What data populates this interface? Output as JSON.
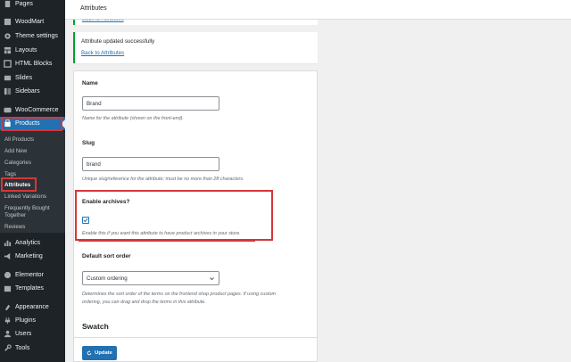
{
  "sidebar": {
    "items": [
      {
        "label": "Pages",
        "icon": "pages-icon"
      },
      {
        "label": "WoodMart",
        "icon": "woodmart-icon"
      },
      {
        "label": "Theme settings",
        "icon": "gear-icon"
      },
      {
        "label": "Layouts",
        "icon": "layouts-icon"
      },
      {
        "label": "HTML Blocks",
        "icon": "html-blocks-icon"
      },
      {
        "label": "Slides",
        "icon": "slides-icon"
      },
      {
        "label": "Sidebars",
        "icon": "sidebars-icon"
      },
      {
        "label": "WooCommerce",
        "icon": "woocommerce-icon"
      },
      {
        "label": "Products",
        "icon": "products-icon"
      }
    ],
    "submenu": [
      "All Products",
      "Add New",
      "Categories",
      "Tags",
      "Attributes",
      "Linked Variations",
      "Frequently Bought",
      "Together",
      "Reviews"
    ],
    "items_after": [
      {
        "label": "Analytics",
        "icon": "analytics-icon"
      },
      {
        "label": "Marketing",
        "icon": "marketing-icon"
      },
      {
        "label": "Elementor",
        "icon": "elementor-icon"
      },
      {
        "label": "Templates",
        "icon": "templates-icon"
      },
      {
        "label": "Appearance",
        "icon": "appearance-icon"
      },
      {
        "label": "Plugins",
        "icon": "plugins-icon"
      },
      {
        "label": "Users",
        "icon": "users-icon"
      },
      {
        "label": "Tools",
        "icon": "tools-icon"
      }
    ]
  },
  "topbar": {
    "title": "Attributes"
  },
  "notice": {
    "message": "Attribute updated successfully",
    "link": "Back to Attributes"
  },
  "form": {
    "name_label": "Name",
    "name_value": "Brand",
    "name_desc": "Name for the attribute (shown on the front-end).",
    "slug_label": "Slug",
    "slug_value": "brand",
    "slug_desc": "Unique slug/reference for the attribute; must be no more than 28 characters.",
    "archives_label": "Enable archives?",
    "archives_checked": true,
    "archives_desc": "Enable this if you want this attribute to have product archives in your store.",
    "sort_label": "Default sort order",
    "sort_value": "Custom ordering",
    "sort_desc_1": "Determines the sort order of the terms on the frontend shop product pages. If using custom",
    "sort_desc_2": "ordering, you can drag and drop the terms in this attribute.",
    "swatch_heading": "Swatch",
    "update_label": "Update"
  },
  "colors": {
    "sidebar_bg": "#1d2327",
    "accent": "#2271b1",
    "success": "#00a32a",
    "annotation": "#d63638"
  }
}
